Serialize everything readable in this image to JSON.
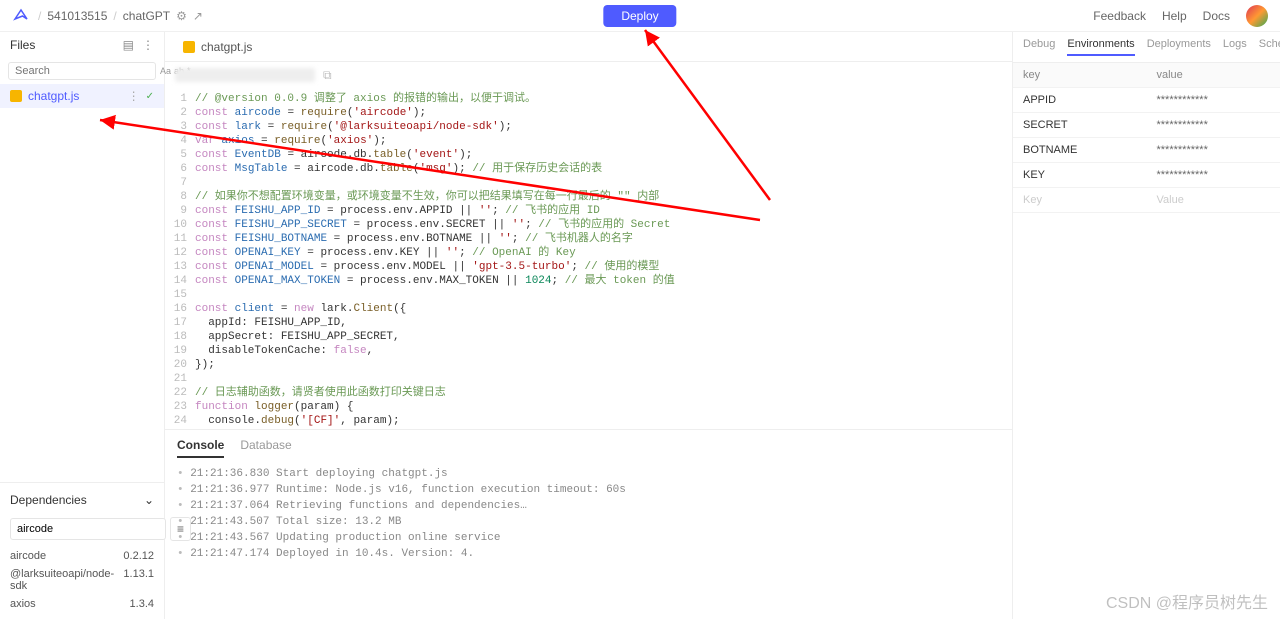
{
  "header": {
    "project_id": "541013515",
    "project_name": "chatGPT",
    "deploy_label": "Deploy",
    "links": [
      "Feedback",
      "Help",
      "Docs"
    ]
  },
  "sidebar": {
    "files_label": "Files",
    "search_placeholder": "Search",
    "search_opts": [
      "Aa",
      "ab",
      "*"
    ],
    "file": {
      "name": "chatgpt.js"
    },
    "deps_label": "Dependencies",
    "dep_input_value": "aircode",
    "deps": [
      {
        "name": "aircode",
        "ver": "0.2.12"
      },
      {
        "name": "@larksuiteoapi/node-sdk",
        "ver": "1.13.1"
      },
      {
        "name": "axios",
        "ver": "1.3.4"
      }
    ]
  },
  "editor": {
    "tab_name": "chatgpt.js",
    "lines": [
      {
        "n": 1,
        "html": "<span class='c-com'>// @version 0.0.9 调整了 axios 的报错的输出，以便于调试。</span>"
      },
      {
        "n": 2,
        "html": "<span class='c-kw'>const</span> <span class='c-var'>aircode</span> = <span class='c-fn'>require</span>(<span class='c-str'>'aircode'</span>);"
      },
      {
        "n": 3,
        "html": "<span class='c-kw'>const</span> <span class='c-var'>lark</span> = <span class='c-fn'>require</span>(<span class='c-str'>'@larksuiteoapi/node-sdk'</span>);"
      },
      {
        "n": 4,
        "html": "<span class='c-kw'>var</span> <span class='c-var'>axios</span> = <span class='c-fn'>require</span>(<span class='c-str'>'axios'</span>);"
      },
      {
        "n": 5,
        "html": "<span class='c-kw'>const</span> <span class='c-var'>EventDB</span> = aircode.db.<span class='c-fn'>table</span>(<span class='c-str'>'event'</span>);"
      },
      {
        "n": 6,
        "html": "<span class='c-kw'>const</span> <span class='c-var'>MsgTable</span> = aircode.db.<span class='c-fn'>table</span>(<span class='c-str'>'msg'</span>); <span class='c-com'>// 用于保存历史会话的表</span>"
      },
      {
        "n": 7,
        "html": ""
      },
      {
        "n": 8,
        "html": "<span class='c-com'>// 如果你不想配置环境变量，或环境变量不生效，你可以把结果填写在每一行最后的 \"\" 内部</span>"
      },
      {
        "n": 9,
        "html": "<span class='c-kw'>const</span> <span class='c-var'>FEISHU_APP_ID</span> = process.env.APPID || <span class='c-str'>''</span>; <span class='c-com'>// 飞书的应用 ID</span>"
      },
      {
        "n": 10,
        "html": "<span class='c-kw'>const</span> <span class='c-var'>FEISHU_APP_SECRET</span> = process.env.SECRET || <span class='c-str'>''</span>; <span class='c-com'>// 飞书的应用的 Secret</span>"
      },
      {
        "n": 11,
        "html": "<span class='c-kw'>const</span> <span class='c-var'>FEISHU_BOTNAME</span> = process.env.BOTNAME || <span class='c-str'>''</span>; <span class='c-com'>// 飞书机器人的名字</span>"
      },
      {
        "n": 12,
        "html": "<span class='c-kw'>const</span> <span class='c-var'>OPENAI_KEY</span> = process.env.KEY || <span class='c-str'>''</span>; <span class='c-com'>// OpenAI 的 Key</span>"
      },
      {
        "n": 13,
        "html": "<span class='c-kw'>const</span> <span class='c-var'>OPENAI_MODEL</span> = process.env.MODEL || <span class='c-str'>'gpt-3.5-turbo'</span>; <span class='c-com'>// 使用的模型</span>"
      },
      {
        "n": 14,
        "html": "<span class='c-kw'>const</span> <span class='c-var'>OPENAI_MAX_TOKEN</span> = process.env.MAX_TOKEN || <span class='c-num'>1024</span>; <span class='c-com'>// 最大 token 的值</span>"
      },
      {
        "n": 15,
        "html": ""
      },
      {
        "n": 16,
        "html": "<span class='c-kw'>const</span> <span class='c-var'>client</span> = <span class='c-kw'>new</span> lark.<span class='c-fn'>Client</span>({"
      },
      {
        "n": 17,
        "html": "  appId: FEISHU_APP_ID,"
      },
      {
        "n": 18,
        "html": "  appSecret: FEISHU_APP_SECRET,"
      },
      {
        "n": 19,
        "html": "  disableTokenCache: <span class='c-kw'>false</span>,"
      },
      {
        "n": 20,
        "html": "});"
      },
      {
        "n": 21,
        "html": ""
      },
      {
        "n": 22,
        "html": "<span class='c-com'>// 日志辅助函数，请贤者使用此函数打印关键日志</span>"
      },
      {
        "n": 23,
        "html": "<span class='c-kw'>function</span> <span class='c-fn'>logger</span>(param) {"
      },
      {
        "n": 24,
        "html": "  console.<span class='c-fn'>debug</span>(<span class='c-str'>'[CF]'</span>, param);"
      }
    ]
  },
  "console": {
    "tabs": [
      "Console",
      "Database"
    ],
    "lines": [
      "21:21:36.830 Start deploying chatgpt.js",
      "21:21:36.977 Runtime: Node.js v16, function execution timeout: 60s",
      "21:21:37.064 Retrieving functions and dependencies…",
      "21:21:43.507 Total size: 13.2 MB",
      "21:21:43.567 Updating production online service",
      "21:21:47.174 Deployed in 10.4s. Version: 4."
    ]
  },
  "rightpanel": {
    "tabs": [
      "Debug",
      "Environments",
      "Deployments",
      "Logs",
      "Schedules"
    ],
    "active_tab": "Environments",
    "header": {
      "key": "key",
      "value": "value"
    },
    "rows": [
      {
        "key": "APPID",
        "value": "************"
      },
      {
        "key": "SECRET",
        "value": "************"
      },
      {
        "key": "BOTNAME",
        "value": "************"
      },
      {
        "key": "KEY",
        "value": "************"
      }
    ],
    "ghost": {
      "key": "Key",
      "value": "Value"
    }
  },
  "watermark": "CSDN @程序员树先生"
}
